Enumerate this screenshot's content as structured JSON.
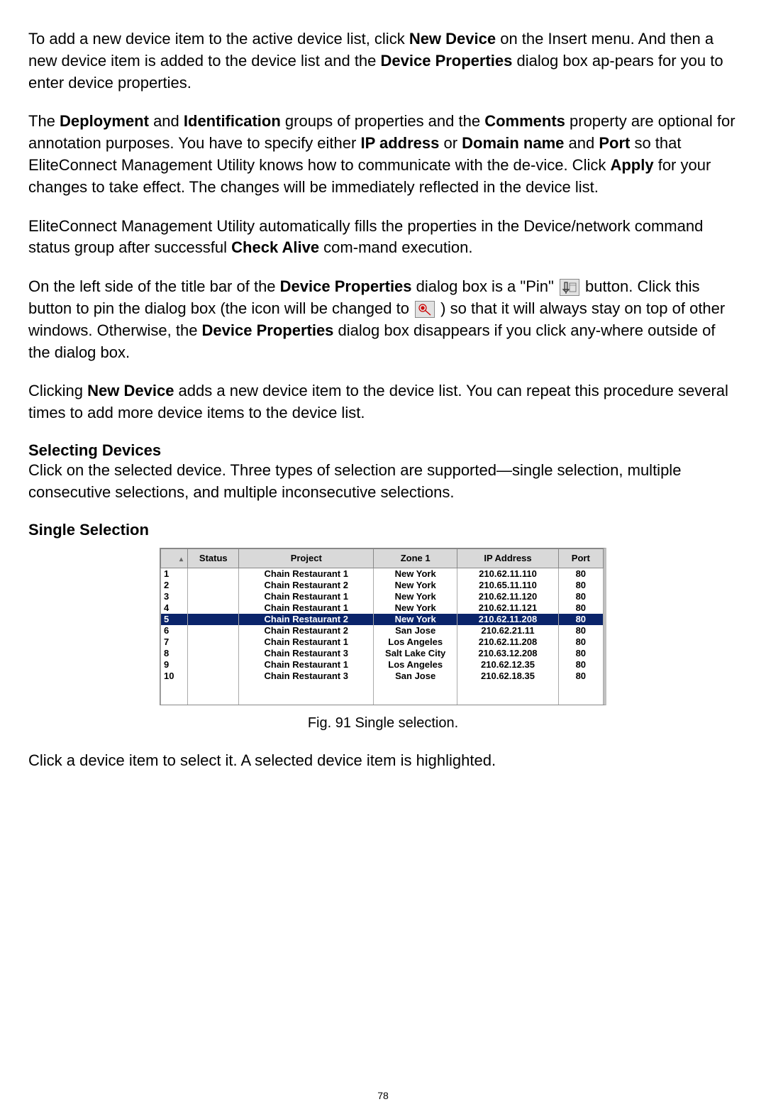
{
  "page_number": "78",
  "para1": {
    "t1": "To add a new device item to the active device list, click ",
    "b1": "New Device",
    "t2": " on the Insert menu. And then a new device item is added to the device list and the ",
    "b2": "Device Properties",
    "t3": " dialog box ap-pears for you to enter device properties."
  },
  "para2": {
    "t1": "The ",
    "b1": "Deployment",
    "t2": " and ",
    "b2": "Identification",
    "t3": " groups of properties and the ",
    "b3": "Comments",
    "t4": " property are optional for annotation purposes. You have to specify either ",
    "b4": "IP address",
    "t5": " or ",
    "b5": "Domain name",
    "t6": " and ",
    "b6": "Port",
    "t7": " so that EliteConnect Management Utility knows how to communicate with the de-vice. Click ",
    "b7": "Apply",
    "t8": " for your changes to take effect. The changes will be immediately reflected in the device list."
  },
  "para3": {
    "t1": "EliteConnect Management Utility automatically fills the properties in the Device/network command status group after successful ",
    "b1": "Check Alive",
    "t2": " com-mand execution."
  },
  "para4": {
    "t1": "On the left side of the title bar of the ",
    "b1": "Device Properties",
    "t2": " dialog box is a \"Pin\" ",
    "t3": " button. Click this button to pin the dialog box (the icon will be changed to ",
    "t4": " ) so that it will always stay on top of other windows. Otherwise, the ",
    "b2": "Device Properties",
    "t5": " dialog box disappears if you click any-where outside of the dialog box."
  },
  "para5": {
    "t1": "Clicking ",
    "b1": "New Device",
    "t2": " adds a new device item to the device list. You can repeat this procedure several times to add more device items to the device list."
  },
  "section_selecting": "Selecting Devices",
  "para6": "Click on the selected device. Three types of selection are supported—single selection, multiple consecutive selections, and multiple inconsecutive selections.",
  "section_single": "Single Selection",
  "table": {
    "headers": {
      "idx": "",
      "status": "Status",
      "project": "Project",
      "zone": "Zone 1",
      "ip": "IP Address",
      "port": "Port"
    },
    "rows": [
      {
        "n": "1",
        "status": "",
        "project": "Chain Restaurant 1",
        "zone": "New York",
        "ip": "210.62.11.110",
        "port": "80",
        "sel": false
      },
      {
        "n": "2",
        "status": "",
        "project": "Chain Restaurant 2",
        "zone": "New York",
        "ip": "210.65.11.110",
        "port": "80",
        "sel": false
      },
      {
        "n": "3",
        "status": "",
        "project": "Chain Restaurant 1",
        "zone": "New York",
        "ip": "210.62.11.120",
        "port": "80",
        "sel": false
      },
      {
        "n": "4",
        "status": "",
        "project": "Chain Restaurant 1",
        "zone": "New York",
        "ip": "210.62.11.121",
        "port": "80",
        "sel": false
      },
      {
        "n": "5",
        "status": "",
        "project": "Chain Restaurant 2",
        "zone": "New York",
        "ip": "210.62.11.208",
        "port": "80",
        "sel": true
      },
      {
        "n": "6",
        "status": "",
        "project": "Chain Restaurant 2",
        "zone": "San Jose",
        "ip": "210.62.21.11",
        "port": "80",
        "sel": false
      },
      {
        "n": "7",
        "status": "",
        "project": "Chain Restaurant 1",
        "zone": "Los Angeles",
        "ip": "210.62.11.208",
        "port": "80",
        "sel": false
      },
      {
        "n": "8",
        "status": "",
        "project": "Chain Restaurant 3",
        "zone": "Salt Lake City",
        "ip": "210.63.12.208",
        "port": "80",
        "sel": false
      },
      {
        "n": "9",
        "status": "",
        "project": "Chain Restaurant 1",
        "zone": "Los Angeles",
        "ip": "210.62.12.35",
        "port": "80",
        "sel": false
      },
      {
        "n": "10",
        "status": "",
        "project": "Chain Restaurant 3",
        "zone": "San Jose",
        "ip": "210.62.18.35",
        "port": "80",
        "sel": false
      }
    ]
  },
  "figure_caption": "Fig. 91 Single selection.",
  "para7": "Click a device item to select it. A selected device item is highlighted."
}
